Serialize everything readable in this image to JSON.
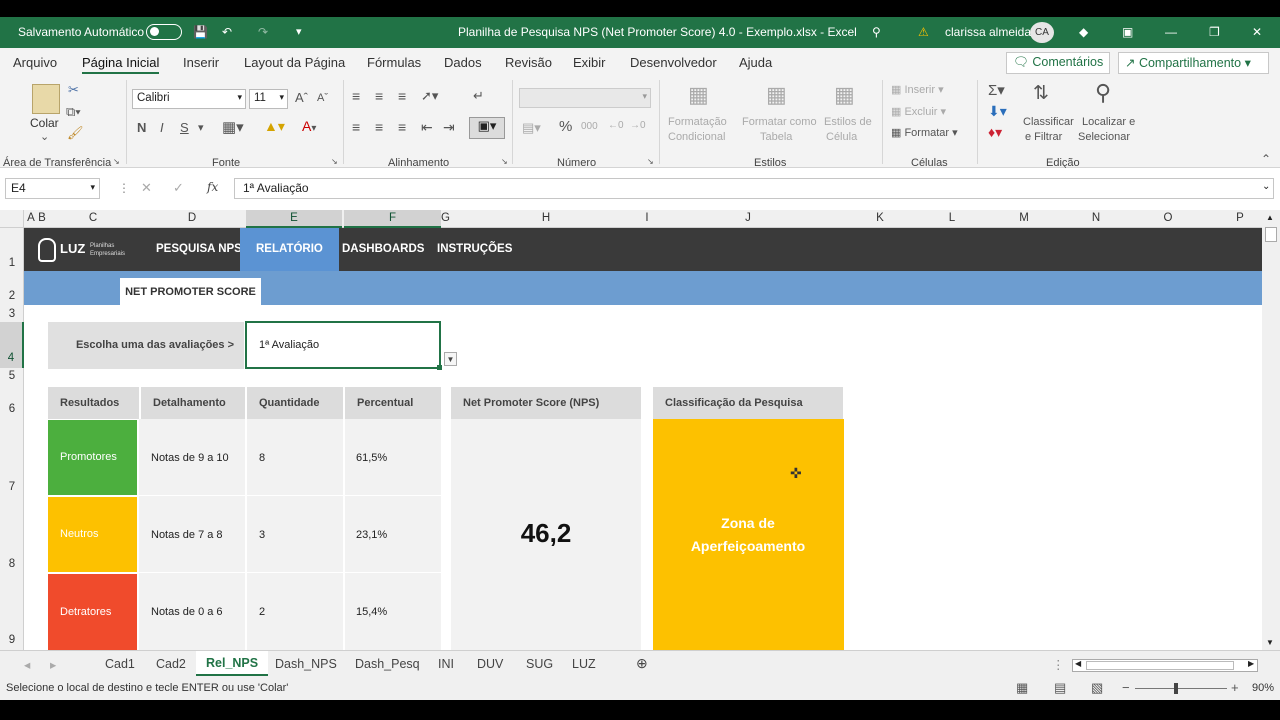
{
  "titlebar": {
    "autosave_label": "Salvamento Automático",
    "doc_title": "Planilha de Pesquisa NPS (Net Promoter Score) 4.0 - Exemplo.xlsx  -  Excel",
    "user_name": "clarissa almeida",
    "user_initials": "CA"
  },
  "menu": {
    "tabs": [
      "Arquivo",
      "Página Inicial",
      "Inserir",
      "Layout da Página",
      "Fórmulas",
      "Dados",
      "Revisão",
      "Exibir",
      "Desenvolvedor",
      "Ajuda"
    ],
    "comments_label": "Comentários",
    "share_label": "Compartilhamento"
  },
  "ribbon": {
    "paste_label": "Colar",
    "font_name": "Calibri",
    "font_size": "11",
    "bold": "N",
    "italic": "I",
    "underline": "S",
    "groups": [
      "Área de Transferência",
      "Fonte",
      "Alinhamento",
      "Número",
      "Estilos",
      "Células",
      "Edição"
    ],
    "cond_format": [
      "Formatação",
      "Condicional"
    ],
    "format_table": [
      "Formatar como",
      "Tabela"
    ],
    "cell_styles": [
      "Estilos de",
      "Célula"
    ],
    "insert": "Inserir",
    "delete": "Excluir",
    "format": "Formatar",
    "sort_filter": [
      "Classificar",
      "e Filtrar"
    ],
    "find_select": [
      "Localizar e",
      "Selecionar"
    ]
  },
  "formula_bar": {
    "name_box": "E4",
    "formula": "1ª Avaliação"
  },
  "columns": [
    "A",
    "B",
    "C",
    "D",
    "E",
    "F",
    "G",
    "H",
    "I",
    "J",
    "K",
    "L",
    "M",
    "N",
    "O",
    "P"
  ],
  "rows": [
    "1",
    "2",
    "3",
    "4",
    "5",
    "6",
    "7",
    "8",
    "9"
  ],
  "sheet": {
    "logo_text": "LUZ",
    "logo_sub": "Planilhas Empresariais",
    "nav": [
      "PESQUISA NPS",
      "RELATÓRIO",
      "DASHBOARDS",
      "INSTRUÇÕES"
    ],
    "section_tab": "NET PROMOTER SCORE",
    "choose_label": "Escolha uma das avaliações >",
    "choose_value": "1ª Avaliação",
    "table_headers": [
      "Resultados",
      "Detalhamento",
      "Quantidade",
      "Percentual"
    ],
    "table_rows": [
      {
        "result": "Promotores",
        "detail": "Notas de 9 a 10",
        "qty": "8",
        "pct": "61,5%",
        "color": "#4caf3e"
      },
      {
        "result": "Neutros",
        "detail": "Notas de 7 a 8",
        "qty": "3",
        "pct": "23,1%",
        "color": "#fdc100"
      },
      {
        "result": "Detratores",
        "detail": "Notas de 0 a 6",
        "qty": "2",
        "pct": "15,4%",
        "color": "#f04b2c"
      }
    ],
    "nps_header": "Net Promoter Score (NPS)",
    "nps_value": "46,2",
    "class_header": "Classificação da Pesquisa",
    "class_value": "Zona de Aperfeiçoamento",
    "class_color": "#fdc100"
  },
  "sheet_tabs": [
    "Cad1",
    "Cad2",
    "Rel_NPS",
    "Dash_NPS",
    "Dash_Pesq",
    "INI",
    "DUV",
    "SUG",
    "LUZ"
  ],
  "active_sheet": "Rel_NPS",
  "status": {
    "message": "Selecione o local de destino e tecle ENTER ou use 'Colar'",
    "zoom": "90%"
  }
}
